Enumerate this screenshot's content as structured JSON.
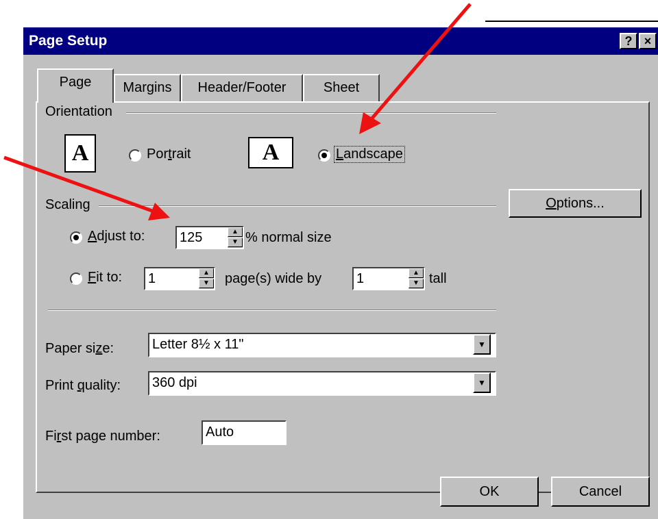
{
  "window": {
    "title": "Page Setup",
    "help_button": "?",
    "close_button": "×"
  },
  "tabs": [
    {
      "label": "Page",
      "active": true
    },
    {
      "label": "Margins",
      "active": false
    },
    {
      "label": "Header/Footer",
      "active": false
    },
    {
      "label": "Sheet",
      "active": false
    }
  ],
  "orientation": {
    "group_label": "Orientation",
    "portrait_icon": "A",
    "landscape_icon": "A",
    "portrait": {
      "pre": "Por",
      "mnemonic": "t",
      "post": "rait",
      "selected": false
    },
    "landscape": {
      "pre": "",
      "mnemonic": "L",
      "post": "andscape",
      "selected": true
    }
  },
  "options_button": {
    "pre": "",
    "mnemonic": "O",
    "post": "ptions..."
  },
  "scaling": {
    "group_label": "Scaling",
    "adjust_to": {
      "pre": "",
      "mnemonic": "A",
      "post": "djust to:",
      "selected": true,
      "value": "125",
      "suffix": "% normal size"
    },
    "fit_to": {
      "pre": "",
      "mnemonic": "F",
      "post": "it to:",
      "selected": false,
      "wide_value": "1",
      "wide_suffix": "page(s) wide by",
      "tall_value": "1",
      "tall_suffix": "tall"
    }
  },
  "paper_size": {
    "pre": "Paper si",
    "mnemonic": "z",
    "post": "e:",
    "value": "Letter 8½ x 11\""
  },
  "print_quality": {
    "pre": "Print ",
    "mnemonic": "q",
    "post": "uality:",
    "value": "360 dpi"
  },
  "first_page_number": {
    "pre": "Fi",
    "mnemonic": "r",
    "post": "st page number:",
    "value": "Auto"
  },
  "buttons": {
    "ok": "OK",
    "cancel": "Cancel"
  },
  "colors": {
    "dialog_bg": "#c0c0c0",
    "titlebar": "#000080",
    "arrow": "#ee1111"
  },
  "icons": {
    "arrows": "red-annotation-arrow"
  }
}
